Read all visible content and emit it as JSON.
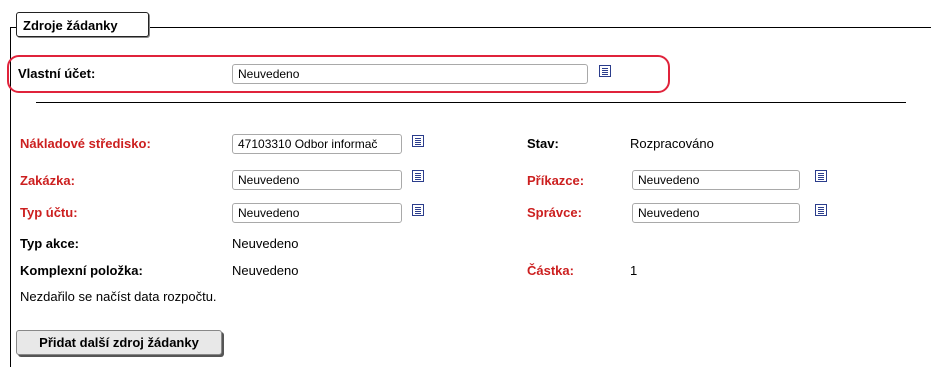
{
  "section": {
    "legend": "Zdroje žádanky"
  },
  "own_account": {
    "label": "Vlastní účet:",
    "value": "Neuvedeno"
  },
  "left_fields": {
    "cost_center": {
      "label": "Nákladové středisko:",
      "value": "47103310 Odbor informač"
    },
    "order": {
      "label": "Zakázka:",
      "value": "Neuvedeno"
    },
    "account_type": {
      "label": "Typ účtu:",
      "value": "Neuvedeno"
    },
    "action_type": {
      "label": "Typ akce:",
      "value": "Neuvedeno"
    },
    "complex_item": {
      "label": "Komplexní položka:",
      "value": "Neuvedeno"
    }
  },
  "right_fields": {
    "state": {
      "label": "Stav:",
      "value": "Rozpracováno"
    },
    "authorizer": {
      "label": "Příkazce:",
      "value": "Neuvedeno"
    },
    "administrator": {
      "label": "Správce:",
      "value": "Neuvedeno"
    },
    "amount": {
      "label": "Částka:",
      "value": "1"
    }
  },
  "budget_error": "Nezdařilo se načíst data rozpočtu.",
  "add_button": "Přidat další zdroj žádanky",
  "colors": {
    "required_label": "#cc1f1f",
    "highlight": "#e0233b",
    "picker_icon": "#2b3d8c"
  },
  "icons": {
    "picker": "list-picker-icon"
  }
}
